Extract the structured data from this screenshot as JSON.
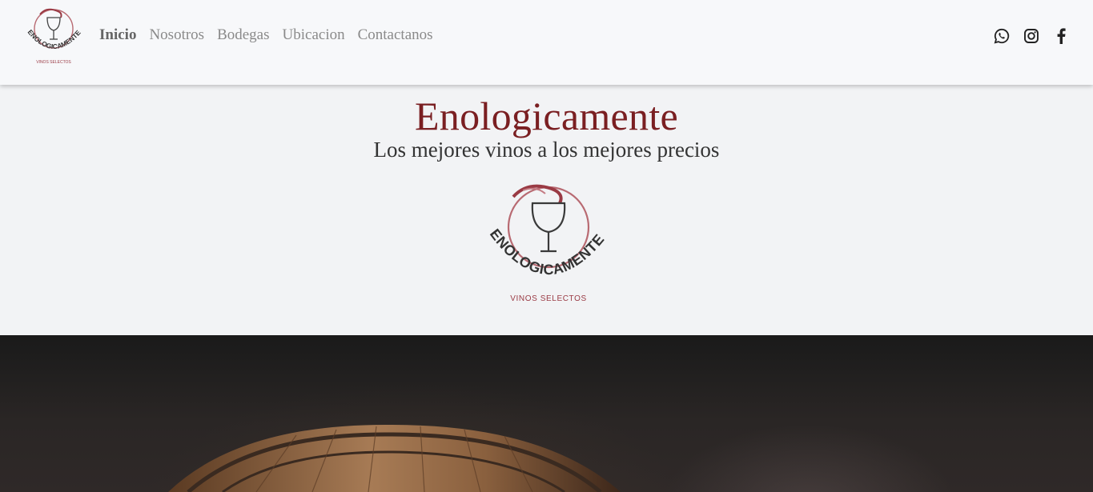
{
  "brand": {
    "logo_wordmark": "ENOLOGICAMENTE",
    "logo_tagline": "VINOS SELECTOS",
    "accent_color": "#7a1f22"
  },
  "nav": {
    "links": [
      {
        "label": "Inicio",
        "active": true
      },
      {
        "label": "Nosotros",
        "active": false
      },
      {
        "label": "Bodegas",
        "active": false
      },
      {
        "label": "Ubicacion",
        "active": false
      },
      {
        "label": "Contactanos",
        "active": false
      }
    ],
    "social": [
      "whatsapp-icon",
      "instagram-icon",
      "facebook-icon"
    ]
  },
  "hero": {
    "title": "Enologicamente",
    "subtitle": "Los mejores vinos a los mejores precios"
  }
}
